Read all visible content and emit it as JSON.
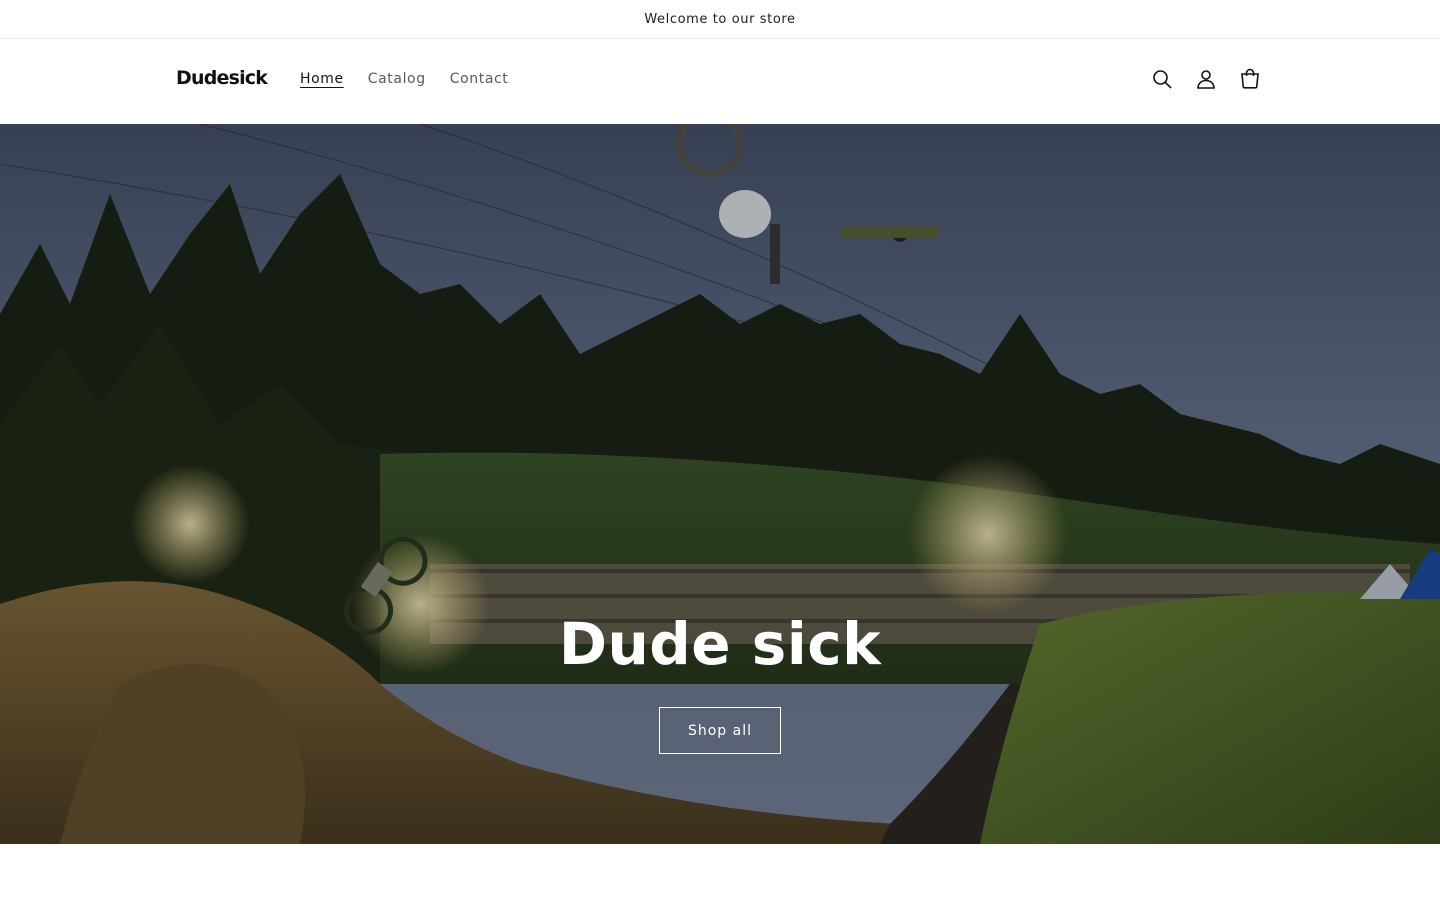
{
  "announcement": {
    "text": "Welcome to our store"
  },
  "header": {
    "logo_text": "Dudesick",
    "nav": [
      {
        "label": "Home",
        "active": true
      },
      {
        "label": "Catalog",
        "active": false
      },
      {
        "label": "Contact",
        "active": false
      }
    ],
    "icons": [
      "search-icon",
      "account-icon",
      "cart-icon"
    ]
  },
  "hero": {
    "title": "Dude sick",
    "button_label": "Shop all",
    "image": "mountain-bike-freestyle-event-at-dusk"
  },
  "colors": {
    "text": "#121212",
    "nav_inactive": "#5a5a5a",
    "hero_text": "#ffffff",
    "divider": "#e6e6e6"
  }
}
